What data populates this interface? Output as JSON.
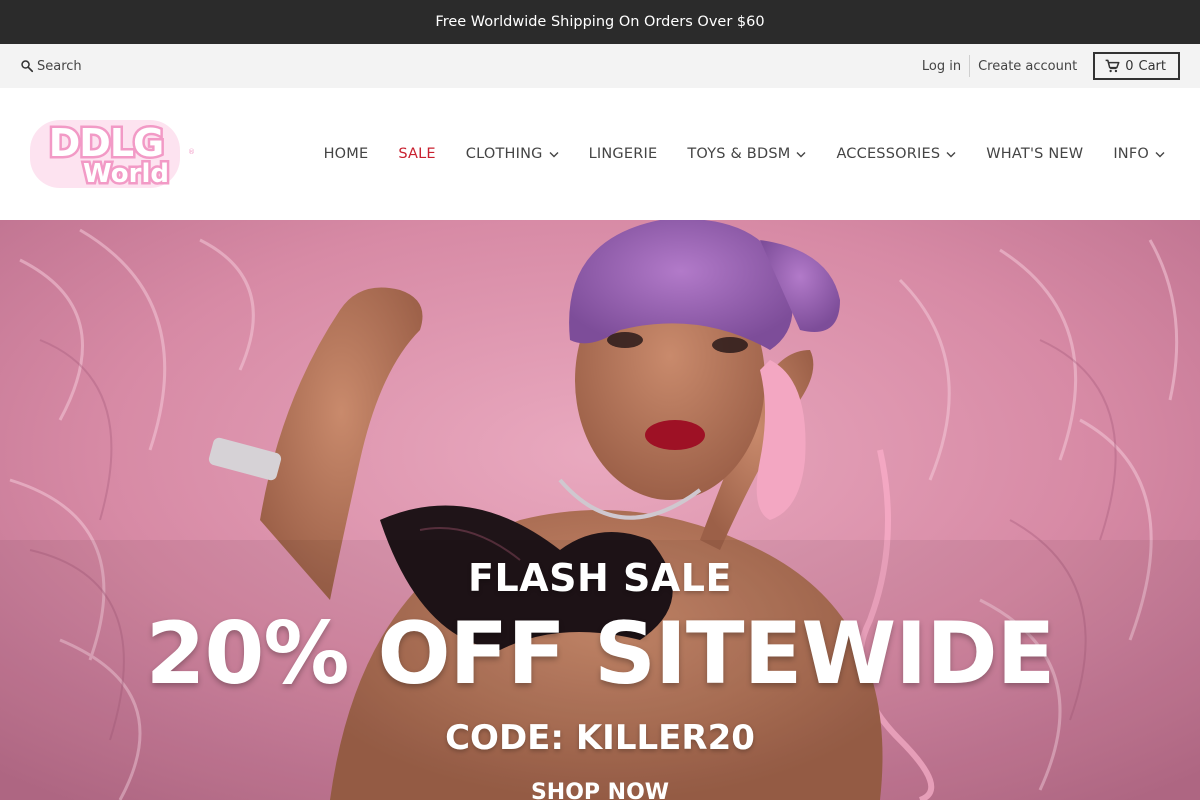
{
  "announcement": {
    "text": "Free Worldwide Shipping On Orders Over $60"
  },
  "utility": {
    "search_label": "Search",
    "login_label": "Log in",
    "create_account_label": "Create account",
    "cart_count": "0",
    "cart_label": "Cart"
  },
  "logo": {
    "line1": "DDLG",
    "line2": "World",
    "mark": "®"
  },
  "nav": {
    "items": [
      {
        "label": "HOME",
        "dropdown": false
      },
      {
        "label": "SALE",
        "dropdown": false,
        "color": "#c8202f"
      },
      {
        "label": "CLOTHING",
        "dropdown": true
      },
      {
        "label": "LINGERIE",
        "dropdown": false
      },
      {
        "label": "TOYS & BDSM",
        "dropdown": true
      },
      {
        "label": "ACCESSORIES",
        "dropdown": true
      },
      {
        "label": "WHAT'S NEW",
        "dropdown": false
      },
      {
        "label": "INFO",
        "dropdown": true
      }
    ]
  },
  "hero": {
    "flash_title": "FLASH SALE",
    "headline": "20% OFF SITEWIDE",
    "code": "CODE: KILLER20",
    "cta": "SHOP NOW"
  },
  "colors": {
    "announcement_bg": "#2b2b2b",
    "utility_bg": "#f3f3f3",
    "sale_red": "#c8202f",
    "logo_pink": "#f29ac6",
    "hero_pink": "#d88ea8"
  },
  "icons": {
    "search": "search-icon",
    "cart": "cart-icon",
    "dropdown": "chevron-down-icon"
  }
}
